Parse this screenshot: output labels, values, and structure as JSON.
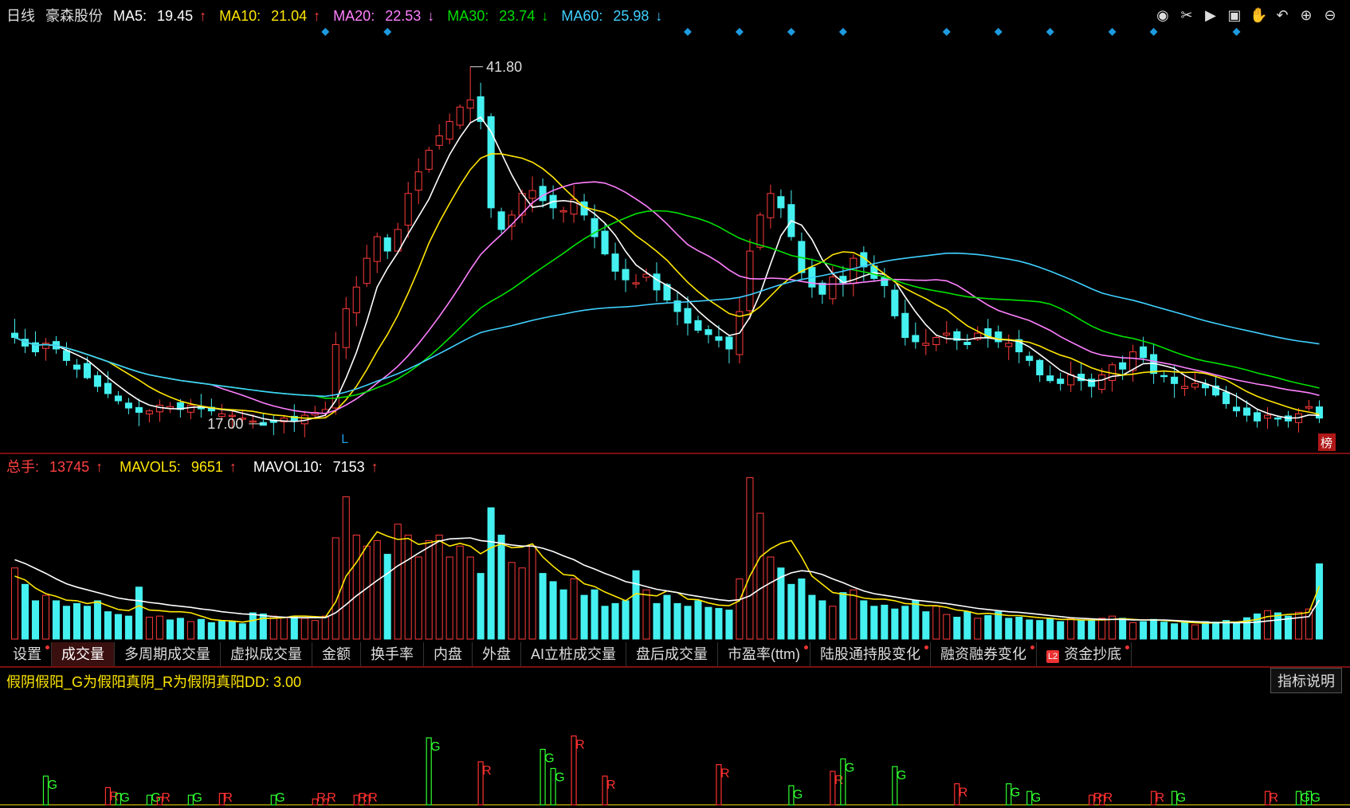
{
  "header": {
    "period": "日线",
    "stock": "豪森股份",
    "ma": [
      {
        "label": "MA5:",
        "value": "19.45",
        "arrow": "↑",
        "color": "#ffffff"
      },
      {
        "label": "MA10:",
        "value": "21.04",
        "arrow": "↑",
        "color": "#ffe600"
      },
      {
        "label": "MA20:",
        "value": "22.53",
        "arrow": "↓",
        "color": "#ff80ff"
      },
      {
        "label": "MA30:",
        "value": "23.74",
        "arrow": "↓",
        "color": "#00e000"
      },
      {
        "label": "MA60:",
        "value": "25.98",
        "arrow": "↓",
        "color": "#40d0ff"
      }
    ]
  },
  "toolbar_icons": [
    "eye-icon",
    "scissors-icon",
    "play-icon",
    "lock-icon",
    "hand-icon",
    "undo-icon",
    "zoom-in-icon",
    "zoom-out-icon"
  ],
  "price_labels": {
    "high": "41.80",
    "low": "17.00",
    "marker_L": "L",
    "badge": "榜"
  },
  "volume_header": {
    "total_label": "总手:",
    "total_value": "13745",
    "total_arrow": "↑",
    "mavol5_label": "MAVOL5:",
    "mavol5_value": "9651",
    "mavol5_arrow": "↑",
    "mavol10_label": "MAVOL10:",
    "mavol10_value": "7153",
    "mavol10_arrow": "↑"
  },
  "tabs": [
    {
      "label": "设置",
      "dot": true
    },
    {
      "label": "成交量",
      "active": true
    },
    {
      "label": "多周期成交量"
    },
    {
      "label": "虚拟成交量"
    },
    {
      "label": "金额"
    },
    {
      "label": "换手率"
    },
    {
      "label": "内盘"
    },
    {
      "label": "外盘"
    },
    {
      "label": "AI立桩成交量"
    },
    {
      "label": "盘后成交量"
    },
    {
      "label": "市盈率(ttm)",
      "dot": true
    },
    {
      "label": "陆股通持股变化",
      "dot": true
    },
    {
      "label": "融资融券变化",
      "dot": true
    },
    {
      "label": "资金抄底",
      "l2": "L2",
      "dot": true
    }
  ],
  "indicator": {
    "title": "假阴假阳_G为假阳真阴_R为假阴真阳DD: 3.00",
    "explain_button": "指标说明"
  },
  "colors": {
    "up": "#ff3b3b",
    "down": "#45f0f0",
    "grid": "#7a1010"
  },
  "chart_data": {
    "type": "candlestick",
    "price_ylim": [
      16,
      44
    ],
    "closes": [
      23.0,
      22.4,
      22.0,
      22.6,
      22.2,
      21.4,
      20.8,
      20.2,
      19.6,
      19.1,
      18.6,
      18.1,
      17.8,
      17.9,
      18.3,
      18.2,
      18.0,
      18.3,
      18.1,
      17.9,
      17.7,
      17.6,
      17.4,
      17.2,
      16.9,
      17.1,
      17.4,
      17.2,
      17.6,
      17.8,
      18.0,
      22.5,
      25.0,
      26.5,
      28.5,
      30.0,
      29.0,
      30.5,
      33.0,
      34.5,
      36.0,
      37.0,
      38.0,
      39.0,
      39.5,
      38.0,
      32.0,
      30.5,
      31.5,
      33.0,
      33.2,
      32.5,
      32.0,
      31.8,
      32.6,
      31.5,
      30.0,
      28.8,
      27.6,
      27.0,
      26.8,
      27.4,
      26.3,
      25.6,
      24.8,
      24.0,
      23.5,
      23.2,
      22.8,
      22.2,
      24.8,
      29.0,
      31.5,
      33.0,
      32.0,
      30.0,
      27.5,
      26.5,
      26.0,
      27.2,
      26.8,
      28.5,
      27.9,
      27.1,
      26.6,
      24.5,
      23.0,
      22.7,
      22.6,
      23.0,
      23.3,
      22.8,
      22.5,
      23.3,
      23.0,
      22.7,
      22.6,
      22.0,
      21.4,
      20.4,
      20.0,
      19.8,
      20.4,
      20.0,
      19.6,
      20.4,
      21.1,
      20.8,
      22.0,
      21.6,
      20.5,
      20.3,
      19.8,
      19.6,
      19.8,
      19.5,
      19.0,
      18.4,
      17.9,
      17.6,
      17.2,
      17.6,
      17.4,
      17.2,
      17.7,
      18.2,
      17.4
    ],
    "volume_ylim": [
      0,
      30000
    ],
    "volumes": [
      13000,
      10000,
      7000,
      8000,
      7000,
      6000,
      6500,
      6000,
      7000,
      5000,
      4500,
      4200,
      9500,
      4000,
      4200,
      3500,
      3800,
      3200,
      3600,
      3000,
      3400,
      3200,
      2800,
      4800,
      4600,
      4200,
      4000,
      4200,
      3800,
      3400,
      4200,
      18500,
      26000,
      19000,
      17000,
      18000,
      15500,
      21000,
      19000,
      15000,
      18000,
      19000,
      15000,
      17000,
      15000,
      12000,
      24000,
      19000,
      14000,
      13000,
      17000,
      12000,
      10500,
      9000,
      11000,
      8000,
      9000,
      6000,
      6500,
      7000,
      12500,
      9000,
      6500,
      8000,
      6500,
      6000,
      7000,
      5800,
      5600,
      5300,
      11000,
      29500,
      23000,
      15000,
      13000,
      10000,
      11000,
      8000,
      7000,
      6000,
      8500,
      9000,
      7000,
      6000,
      6200,
      5500,
      6000,
      7000,
      5000,
      6000,
      4500,
      4000,
      5000,
      3800,
      4300,
      5000,
      3800,
      4000,
      3500,
      3400,
      3800,
      3200,
      3700,
      3500,
      3400,
      3800,
      4200,
      3800,
      3000,
      3200,
      3600,
      3100,
      2800,
      3000,
      2600,
      3200,
      3100,
      3400,
      3000,
      3900,
      4600,
      5200,
      4800,
      4200,
      4900,
      5500,
      13745
    ],
    "mavol5": [
      11500,
      10800,
      9300,
      8300,
      7800,
      7100,
      7000,
      6500,
      6800,
      6100,
      5400,
      5200,
      6100,
      5300,
      5200,
      5000,
      5000,
      4800,
      4200,
      3600,
      3400,
      3300,
      3100,
      3400,
      3800,
      3800,
      3900,
      4200,
      4200,
      4100,
      4000,
      6800,
      11500,
      14000,
      17000,
      19600,
      18800,
      18200,
      18400,
      17300,
      17600,
      18000,
      17000,
      17500,
      17000,
      15600,
      16700,
      17400,
      16700,
      16800,
      17400,
      15000,
      13300,
      11800,
      11600,
      10100,
      9600,
      8600,
      7800,
      7000,
      8300,
      8100,
      7900,
      8800,
      8500,
      7300,
      7200,
      6600,
      6200,
      6100,
      7000,
      11500,
      15000,
      16500,
      17500,
      18000,
      15000,
      11500,
      10000,
      8500,
      8200,
      8000,
      7500,
      7300,
      7300,
      7000,
      6500,
      6400,
      6100,
      6100,
      5800,
      5300,
      5100,
      4600,
      4700,
      4500,
      4300,
      4300,
      4100,
      3900,
      3800,
      3600,
      3600,
      3500,
      3500,
      3500,
      3600,
      3700,
      3600,
      3500,
      3500,
      3400,
      3300,
      3100,
      3000,
      2900,
      3000,
      3100,
      3100,
      3300,
      3600,
      4100,
      4300,
      4500,
      4600,
      4900,
      9651
    ],
    "mavol10": [
      14500,
      13800,
      12900,
      12000,
      11000,
      10100,
      9500,
      9000,
      8500,
      8000,
      7500,
      7200,
      7000,
      6700,
      6500,
      6200,
      6000,
      5800,
      5500,
      5300,
      5000,
      4800,
      4600,
      4500,
      4300,
      4100,
      4000,
      3900,
      3900,
      3900,
      3900,
      4800,
      6300,
      7900,
      9300,
      10700,
      12000,
      13400,
      14500,
      15700,
      16800,
      17900,
      18300,
      18400,
      18500,
      18000,
      17800,
      17500,
      17200,
      17000,
      17000,
      16600,
      16000,
      15200,
      14500,
      13500,
      12800,
      12000,
      11300,
      10500,
      10100,
      9600,
      9100,
      8800,
      8500,
      8100,
      7800,
      7500,
      7200,
      7000,
      7200,
      7900,
      9200,
      10300,
      11300,
      12100,
      12500,
      12300,
      11800,
      11000,
      10300,
      9500,
      8800,
      8300,
      8000,
      7700,
      7400,
      7100,
      6900,
      6700,
      6500,
      6200,
      5900,
      5600,
      5400,
      5200,
      5000,
      4900,
      4700,
      4500,
      4300,
      4100,
      3900,
      3800,
      3700,
      3600,
      3600,
      3600,
      3500,
      3500,
      3500,
      3500,
      3400,
      3300,
      3200,
      3100,
      3000,
      3000,
      3000,
      3000,
      3100,
      3300,
      3500,
      3700,
      3900,
      4100,
      7153
    ],
    "signals": [
      {
        "i": 3,
        "t": "G",
        "h": 0.3
      },
      {
        "i": 9,
        "t": "R",
        "h": 0.18
      },
      {
        "i": 10,
        "t": "G",
        "h": 0.12
      },
      {
        "i": 13,
        "t": "G",
        "h": 0.1
      },
      {
        "i": 14,
        "t": "R",
        "h": 0.08
      },
      {
        "i": 17,
        "t": "G",
        "h": 0.1
      },
      {
        "i": 20,
        "t": "R",
        "h": 0.12
      },
      {
        "i": 25,
        "t": "G",
        "h": 0.1
      },
      {
        "i": 29,
        "t": "R",
        "h": 0.06
      },
      {
        "i": 30,
        "t": "R",
        "h": 0.06
      },
      {
        "i": 33,
        "t": "R",
        "h": 0.1
      },
      {
        "i": 34,
        "t": "R",
        "h": 0.1
      },
      {
        "i": 40,
        "t": "G",
        "h": 0.7
      },
      {
        "i": 45,
        "t": "R",
        "h": 0.45
      },
      {
        "i": 51,
        "t": "G",
        "h": 0.58
      },
      {
        "i": 52,
        "t": "G",
        "h": 0.38
      },
      {
        "i": 54,
        "t": "R",
        "h": 0.72
      },
      {
        "i": 57,
        "t": "R",
        "h": 0.3
      },
      {
        "i": 68,
        "t": "R",
        "h": 0.42
      },
      {
        "i": 75,
        "t": "G",
        "h": 0.2
      },
      {
        "i": 79,
        "t": "R",
        "h": 0.35
      },
      {
        "i": 80,
        "t": "G",
        "h": 0.48
      },
      {
        "i": 85,
        "t": "G",
        "h": 0.4
      },
      {
        "i": 91,
        "t": "R",
        "h": 0.22
      },
      {
        "i": 96,
        "t": "G",
        "h": 0.22
      },
      {
        "i": 98,
        "t": "G",
        "h": 0.14
      },
      {
        "i": 104,
        "t": "R",
        "h": 0.1
      },
      {
        "i": 105,
        "t": "R",
        "h": 0.1
      },
      {
        "i": 110,
        "t": "R",
        "h": 0.14
      },
      {
        "i": 112,
        "t": "G",
        "h": 0.14
      },
      {
        "i": 121,
        "t": "R",
        "h": 0.14
      },
      {
        "i": 124,
        "t": "G",
        "h": 0.14
      },
      {
        "i": 125,
        "t": "G",
        "h": 0.14
      },
      {
        "i": 133,
        "t": "G",
        "h": 0.1
      },
      {
        "i": 134,
        "t": "R",
        "h": 0.1
      }
    ],
    "markers_idx": [
      30,
      36,
      65,
      70,
      75,
      80,
      90,
      95,
      100,
      106,
      110,
      118
    ]
  }
}
